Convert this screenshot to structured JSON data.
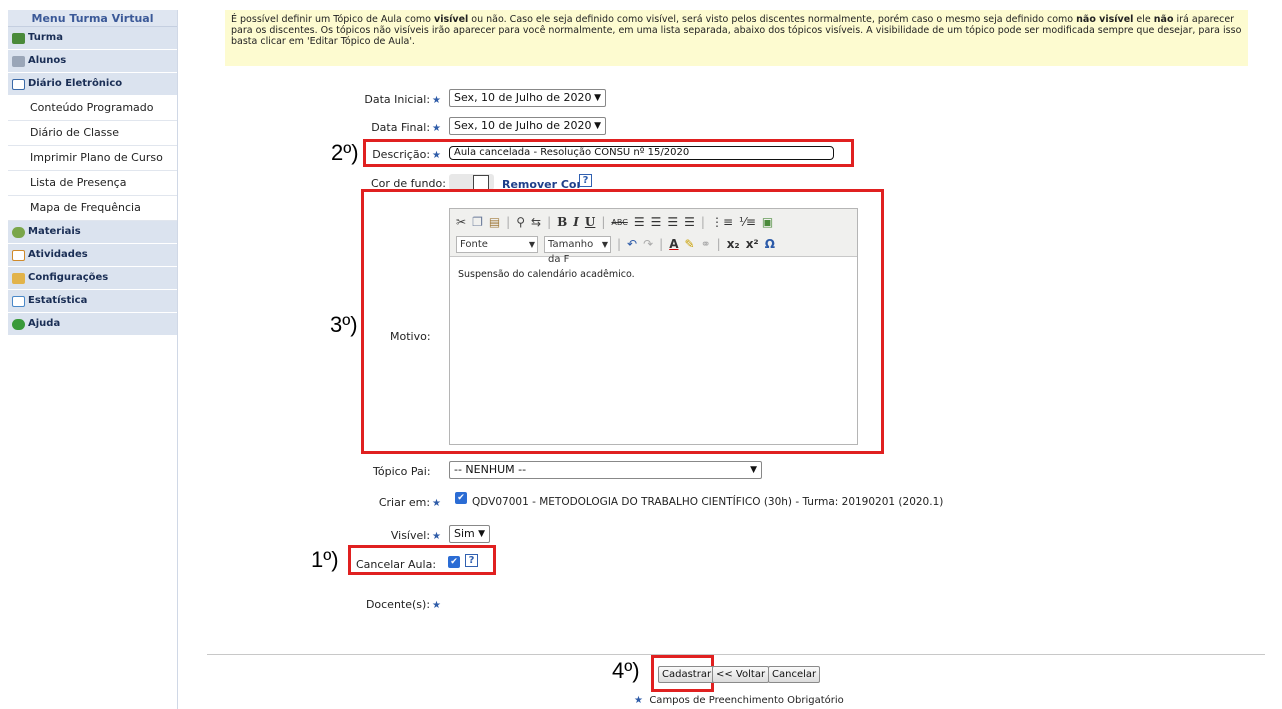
{
  "sidebar": {
    "title": "Menu Turma Virtual",
    "items": [
      {
        "label": "Turma",
        "icon": "group-icon",
        "color": "#4a8a3a"
      },
      {
        "label": "Alunos",
        "icon": "students-icon",
        "color": "#7f8fa6"
      },
      {
        "label": "Diário Eletrônico",
        "icon": "book-icon",
        "color": "#3b6aa8"
      }
    ],
    "subitems": [
      "Conteúdo Programado",
      "Diário de Classe",
      "Imprimir Plano de Curso",
      "Lista de Presença",
      "Mapa de Frequência"
    ],
    "items2": [
      {
        "label": "Materiais",
        "icon": "materials-icon",
        "color": "#6a9a3a"
      },
      {
        "label": "Atividades",
        "icon": "activities-icon",
        "color": "#d08a2a"
      },
      {
        "label": "Configurações",
        "icon": "config-icon",
        "color": "#c99a2a"
      },
      {
        "label": "Estatística",
        "icon": "stats-icon",
        "color": "#4a88c8"
      },
      {
        "label": "Ajuda",
        "icon": "help-icon",
        "color": "#3a9a3a"
      }
    ]
  },
  "info": {
    "p1": "É possível definir um Tópico de Aula como ",
    "b1": "visível",
    "p2": " ou não. Caso ele seja definido como visível, será visto pelos discentes normalmente, porém caso o mesmo seja definido como ",
    "b2": "não visível",
    "p3": " ele ",
    "b3": "não",
    "p4": " irá aparecer para os discentes. Os tópicos não visíveis irão aparecer para você normalmente, em uma lista separada, abaixo dos tópicos visíveis. A visibilidade de um tópico pode ser modificada sempre que desejar, para isso basta clicar em 'Editar Tópico de Aula'."
  },
  "form": {
    "data_inicial_label": "Data Inicial:",
    "data_inicial_value": "Sex, 10 de Julho de 2020",
    "data_final_label": "Data Final:",
    "data_final_value": "Sex, 10 de Julho de 2020",
    "descricao_label": "Descrição:",
    "descricao_value": "Aula cancelada - Resolução CONSU nº 15/2020",
    "cor_label": "Cor de fundo:",
    "remover_cor": "Remover Cor",
    "motivo_label": "Motivo:",
    "motivo_text": "Suspensão do calendário acadêmico.",
    "editor_fonte": "Fonte",
    "editor_tamanho": "Tamanho da F",
    "topico_pai_label": "Tópico Pai:",
    "topico_pai_value": "-- NENHUM --",
    "criar_em_label": "Criar em:",
    "criar_em_value": "QDV07001 - METODOLOGIA DO TRABALHO CIENTÍFICO (30h) - Turma: 20190201 (2020.1)",
    "visivel_label": "Visível:",
    "visivel_value": "Sim",
    "cancelar_aula_label": "Cancelar Aula:",
    "docentes_label": "Docente(s):",
    "required_star": "★",
    "help_mark": "?"
  },
  "buttons": {
    "cadastrar": "Cadastrar",
    "voltar": "<< Voltar",
    "cancelar": "Cancelar"
  },
  "footer_note": "Campos de Preenchimento Obrigatório",
  "steps": {
    "s1": "1º)",
    "s2": "2º)",
    "s3": "3º)",
    "s4": "4º)"
  },
  "colors": {
    "highlight_red": "#e02020",
    "info_bg": "#fdfbd0",
    "menu_bg": "#dbe3ef",
    "link_blue": "#1f3f8a"
  }
}
